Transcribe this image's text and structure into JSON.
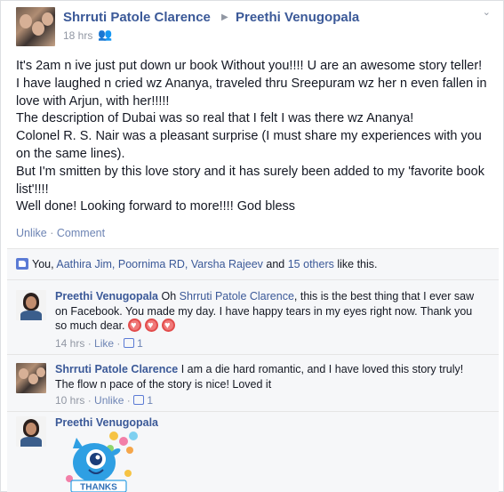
{
  "post": {
    "author": "Shrruti Patole Clarence",
    "recipient": "Preethi Venugopala",
    "time": "18 hrs",
    "privacy_icon": "friends-icon",
    "menu_icon": "chevron-down-icon",
    "body": [
      "It's 2am n ive just put down ur book Without you!!!! U are an awesome story teller! I have laughed n cried wz Ananya, traveled thru Sreepuram wz her n even fallen in love with Arjun, with her!!!!!",
      "The description of Dubai was so real that I felt I was there wz Ananya!",
      "Colonel R. S. Nair was a pleasant surprise (I must share my experiences with you on the same lines).",
      "But I'm smitten by this love story and it has surely been added to my 'favorite book list'!!!!",
      "Well done! Looking forward to more!!!! God bless"
    ],
    "actions": {
      "unlike": "Unlike",
      "separator": "·",
      "comment": "Comment"
    }
  },
  "likes": {
    "you": "You,",
    "names": [
      "Aathira Jim,",
      "Poornima RD,",
      "Varsha Rajeev"
    ],
    "and": "and",
    "others": "15 others",
    "suffix": "like this."
  },
  "comments": [
    {
      "author": "Preethi Venugopala",
      "text_before": "Oh",
      "mention": "Shrruti Patole Clarence",
      "text_after": ", this is the best thing that I ever saw on Facebook. You made my day. I have happy tears in my eyes right now. Thank you so much dear.",
      "time": "14 hrs",
      "action": "Like",
      "like_count": "1"
    },
    {
      "author": "Shrruti Patole Clarence",
      "text": "I am a die hard romantic, and I have loved this story truly! The flow n pace of the story is nice! Loved it",
      "time": "10 hrs",
      "action": "Unlike",
      "like_count": "1"
    },
    {
      "author": "Preethi Venugopala",
      "sticker_text": "THANKS"
    }
  ],
  "colors": {
    "link": "#3b5998",
    "muted": "#9197a3",
    "action": "#6d84b4",
    "ufi_bg": "#f6f7f9",
    "heart": "#f07a7a"
  }
}
